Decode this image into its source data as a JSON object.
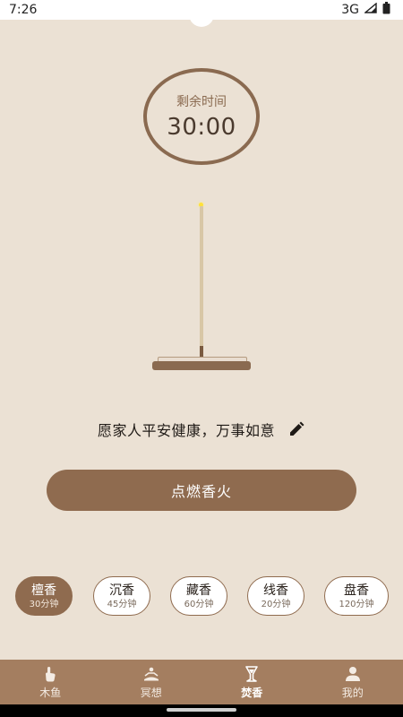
{
  "status_bar": {
    "time": "7:26",
    "network": "3G"
  },
  "timer": {
    "label": "剩余时间",
    "value": "30:00"
  },
  "wish": {
    "text": "愿家人平安健康，万事如意"
  },
  "actions": {
    "light_button": "点燃香火"
  },
  "incense_options": [
    {
      "name": "檀香",
      "duration": "30分钟",
      "selected": true
    },
    {
      "name": "沉香",
      "duration": "45分钟",
      "selected": false
    },
    {
      "name": "藏香",
      "duration": "60分钟",
      "selected": false
    },
    {
      "name": "线香",
      "duration": "20分钟",
      "selected": false
    },
    {
      "name": "盘香",
      "duration": "120分钟",
      "selected": false
    }
  ],
  "tabs": [
    {
      "label": "木鱼",
      "icon": "hand-tap-icon",
      "active": false
    },
    {
      "label": "冥想",
      "icon": "meditation-icon",
      "active": false
    },
    {
      "label": "焚香",
      "icon": "incense-icon",
      "active": true
    },
    {
      "label": "我的",
      "icon": "person-icon",
      "active": false
    }
  ],
  "colors": {
    "background": "#ebe1d4",
    "accent": "#8f6b4f",
    "tab_bar": "#a47e60"
  }
}
